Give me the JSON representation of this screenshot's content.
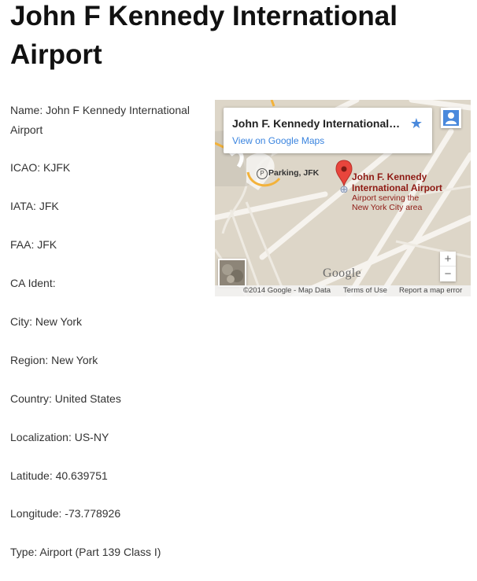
{
  "page": {
    "title": "John F Kennedy International Airport"
  },
  "details": [
    "Name: John F Kennedy International Airport",
    "ICAO: KJFK",
    "IATA: JFK",
    "FAA: JFK",
    "CA Ident:",
    "City: New York",
    "Region: New York",
    "Country: United States",
    "Localization: US-NY",
    "Latitude: 40.639751",
    "Longitude: -73.778926",
    "Type: Airport (Part 139 Class I)"
  ],
  "map": {
    "card_title": "John F. Kennedy International A...",
    "card_link": "View on Google Maps",
    "pin_title_line1": "John F. Kennedy",
    "pin_title_line2": "International Airport",
    "pin_sub_line1": "Airport serving the",
    "pin_sub_line2": "New York City area",
    "parking_label": "Parking, JFK",
    "parking_icon": "P",
    "zoom_in": "+",
    "zoom_out": "−",
    "google_logo": "Google",
    "footer_data": "©2014 Google - Map Data",
    "footer_terms": "Terms of Use",
    "footer_report": "Report a map error",
    "star": "★",
    "colors": {
      "land": "#ddd6c8",
      "runway": "#f6f3ee",
      "pin_red": "#e8453c",
      "label_red": "#8e1a14",
      "link_blue": "#3a84df"
    }
  }
}
